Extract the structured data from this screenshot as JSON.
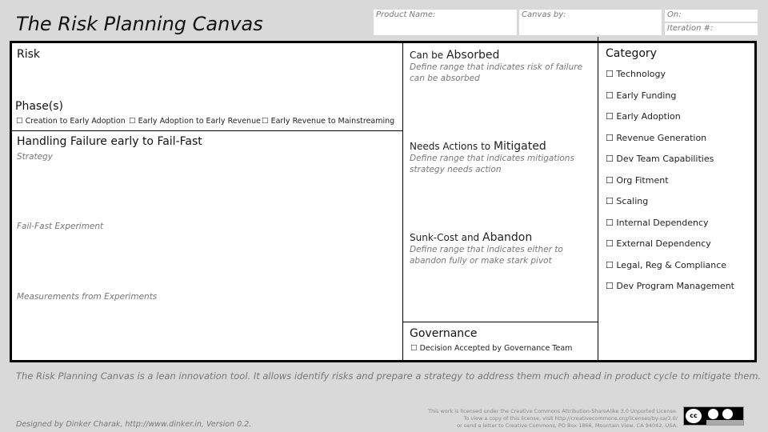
{
  "header": {
    "title": "The Risk Planning Canvas",
    "product_name": "Product Name:",
    "canvas_by": "Canvas by:",
    "on": "On:",
    "iteration": "Iteration #:"
  },
  "risk": {
    "label": "Risk"
  },
  "phases": {
    "label": "Phase(s)",
    "options": [
      "Creation to Early Adoption",
      "Early Adoption to Early Revenue",
      "Early Revenue to Mainstreaming"
    ]
  },
  "handling": {
    "label": "Handling Failure early to Fail-Fast",
    "strategy": "Strategy",
    "experiment": "Fail-Fast Experiment",
    "measurements": "Measurements from Experiments"
  },
  "absorbed": {
    "prefix": "Can be ",
    "word": "Absorbed",
    "desc": "Define range that indicates risk of failure can be absorbed"
  },
  "mitigated": {
    "prefix": "Needs Actions to ",
    "word": "Mitigated",
    "desc": "Define range that indicates mitigations strategy needs action"
  },
  "abandon": {
    "prefix": "Sunk-Cost and ",
    "word": "Abandon",
    "desc": "Define range that indicates either to abandon fully or make stark pivot"
  },
  "governance": {
    "label": "Governance",
    "option": "Decision Accepted by Governance Team"
  },
  "category": {
    "label": "Category",
    "items": [
      "Technology",
      "Early Funding",
      "Early Adoption",
      "Revenue Generation",
      "Dev Team Capabilities",
      "Org Fitment",
      "Scaling",
      "Internal Dependency",
      "External Dependency",
      "Legal, Reg & Compliance",
      "Dev Program Management"
    ]
  },
  "footer": {
    "tagline": "The Risk Planning Canvas is a lean innovation tool. It allows identify risks and prepare a strategy to address them much ahead in product cycle to mitigate them.",
    "credit": "Designed by Dinker Charak, http://www.dinker.in, Version 0.2.",
    "license": [
      "This work is licensed under the Creative Commons Attribution-ShareAlike 3.0 Unported License.",
      "To view a copy of this license, visit http://creativecommons.org/licenses/by-sa/3.0/",
      "or send a letter to Creative Commons, PO Box 1866, Mountain View, CA 94042, USA."
    ],
    "cc_logo": "cc by-sa",
    "checkbox_glyph": "☐"
  }
}
